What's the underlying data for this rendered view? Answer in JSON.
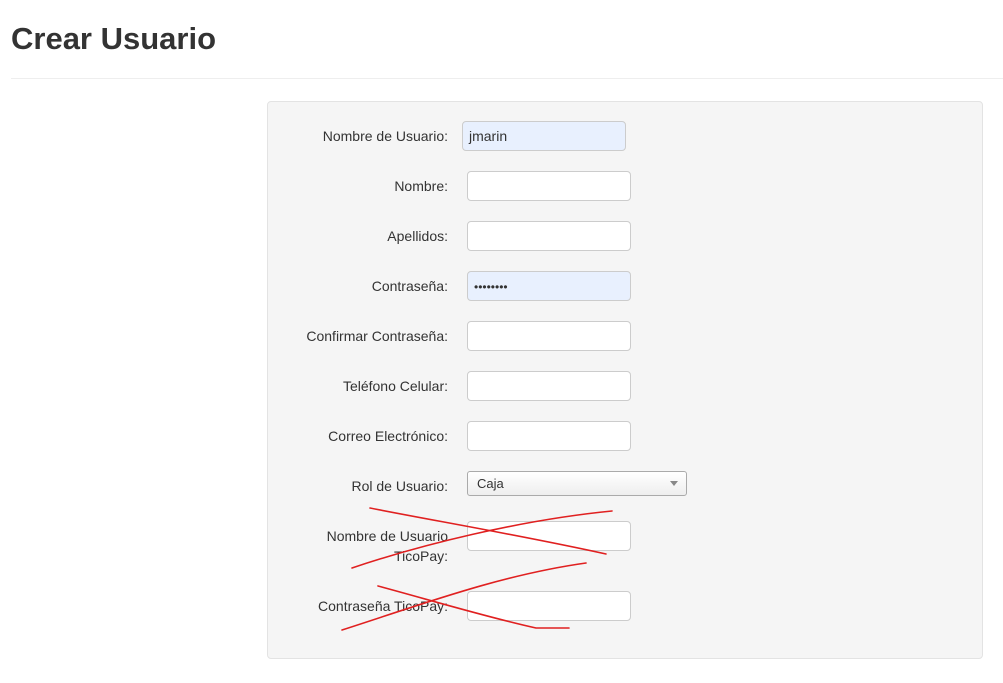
{
  "header": {
    "title": "Crear Usuario"
  },
  "form": {
    "username": {
      "label": "Nombre de Usuario:",
      "value": "jmarin"
    },
    "first_name": {
      "label": "Nombre:",
      "value": ""
    },
    "last_name": {
      "label": "Apellidos:",
      "value": ""
    },
    "password": {
      "label": "Contraseña:",
      "masked_value": "••••••••"
    },
    "confirm_password": {
      "label": "Confirmar Contraseña:",
      "value": ""
    },
    "cell_phone": {
      "label": "Teléfono Celular:",
      "value": ""
    },
    "email": {
      "label": "Correo Electrónico:",
      "value": ""
    },
    "role": {
      "label": "Rol de Usuario:",
      "selected": "Caja"
    },
    "ticopay_username": {
      "label_line1": "Nombre de Usuario",
      "label_line2": "TicoPay:",
      "value": "",
      "crossed_out": true
    },
    "ticopay_password": {
      "label": "Contraseña TicoPay:",
      "value": "",
      "crossed_out": true
    }
  },
  "colors": {
    "autofill_bg": "#e8f0fe",
    "well_bg": "#f5f5f5",
    "scribble": "#e02020"
  }
}
